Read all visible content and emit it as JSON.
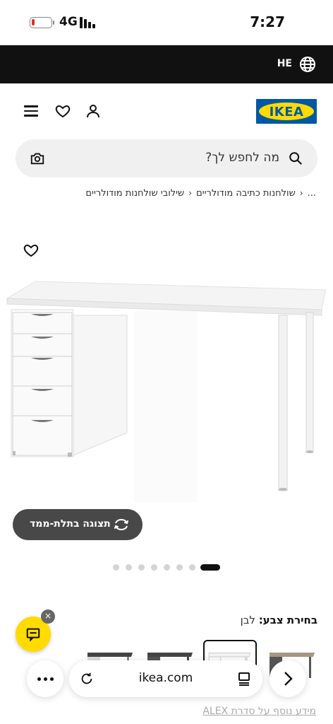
{
  "status_bar": {
    "network": "4G",
    "time": "7:27",
    "battery_level": 0.1
  },
  "lang_bar": {
    "code": "HE"
  },
  "header": {
    "logo_text": "IKEA"
  },
  "search": {
    "placeholder": "מה לחפש לך?"
  },
  "breadcrumb": {
    "ellipsis": "...",
    "items": [
      "שולחנות כתיבה מודולריים",
      "שילובי שולחנות מודולריים"
    ]
  },
  "view_3d": {
    "label": "תצוגה בתלת-ממד"
  },
  "pagination": {
    "total": 8,
    "active_index": 0
  },
  "color_choice": {
    "label": "בחירת צבע:",
    "value": "לבן"
  },
  "chat": {
    "close": "×"
  },
  "browser": {
    "url": "ikea.com"
  },
  "series_link": "מידע נוסף על סדרת ALEX",
  "colors": {
    "ikea_blue": "#0058a3",
    "ikea_yellow": "#ffdb00",
    "dark_button": "#484848"
  }
}
